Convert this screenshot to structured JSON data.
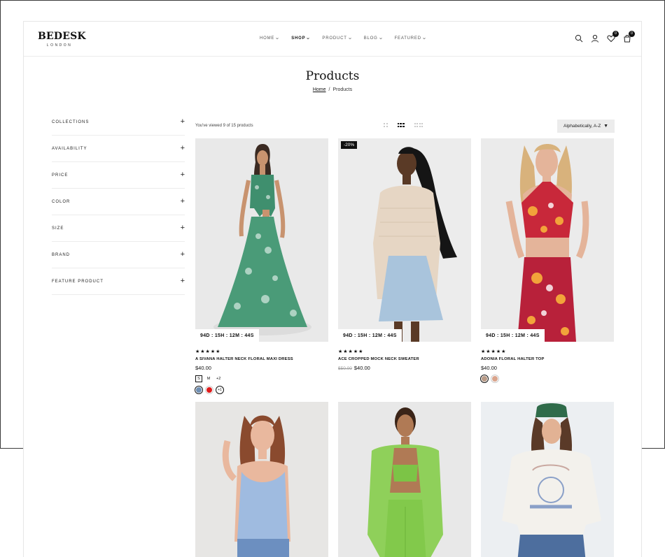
{
  "brand": {
    "name": "BEDESK",
    "tagline": "LONDON"
  },
  "nav": [
    {
      "label": "HOME",
      "active": false
    },
    {
      "label": "SHOP",
      "active": true
    },
    {
      "label": "PRODUCT",
      "active": false
    },
    {
      "label": "BLOG",
      "active": false
    },
    {
      "label": "FEATURED",
      "active": false
    }
  ],
  "header_icons": {
    "wishlist_count": "0",
    "cart_count": "0"
  },
  "page": {
    "title": "Products"
  },
  "breadcrumb": {
    "home": "Home",
    "sep": "/",
    "current": "Products"
  },
  "filters": [
    {
      "label": "COLLECTIONS"
    },
    {
      "label": "AVAILABILITY"
    },
    {
      "label": "PRICE"
    },
    {
      "label": "COLOR"
    },
    {
      "label": "SIZE"
    },
    {
      "label": "BRAND"
    },
    {
      "label": "FEATURE PRODUCT"
    }
  ],
  "filter_toggle": "+",
  "toolbar": {
    "viewed_text": "You've viewed 9 of 15 products",
    "sort_label": "Alphabetically, A-Z",
    "sort_caret": "▼",
    "active_view": "3-columns"
  },
  "products": [
    {
      "name": "A SIVANA HALTER NECK FLORAL MAXI DRESS",
      "price": "$40.00",
      "old_price": "",
      "rating_stars": "★★★★★",
      "countdown": "94D : 15H : 12M : 44S",
      "sale_badge": "",
      "sizes": [
        {
          "label": "S",
          "selected": true
        },
        {
          "label": "M",
          "selected": false
        },
        {
          "label": "+2",
          "selected": false
        }
      ],
      "swatches": [
        {
          "color": "#6f8fb3",
          "selected": true
        },
        {
          "color": "#e01b1b",
          "selected": false
        }
      ],
      "more_swatches": "+1"
    },
    {
      "name": "ACE CROPPED MOCK NECK SWEATER",
      "price": "$40.00",
      "old_price": "$50.00",
      "rating_stars": "★★★★★",
      "countdown": "94D : 15H : 12M : 44S",
      "sale_badge": "-20%"
    },
    {
      "name": "ADONIA FLORAL HALTER TOP",
      "price": "$40.00",
      "old_price": "",
      "rating_stars": "★★★★★",
      "countdown": "94D : 15H : 12M : 44S",
      "sale_badge": "",
      "swatches": [
        {
          "color": "#b89a86",
          "selected": true
        },
        {
          "color": "#d9a48c",
          "selected": false
        }
      ]
    },
    {
      "name": "",
      "image": "woman-blue-knit-top"
    },
    {
      "name": "",
      "image": "woman-green-suit-set"
    },
    {
      "name": "",
      "image": "woman-boston-sweatshirt"
    }
  ]
}
